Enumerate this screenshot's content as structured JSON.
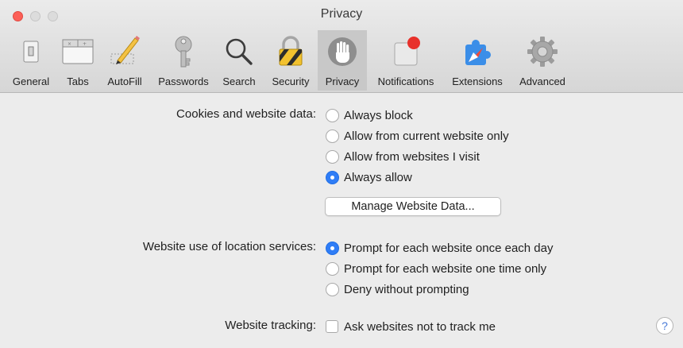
{
  "window": {
    "title": "Privacy"
  },
  "toolbar": {
    "tabs": [
      {
        "label": "General"
      },
      {
        "label": "Tabs"
      },
      {
        "label": "AutoFill"
      },
      {
        "label": "Passwords"
      },
      {
        "label": "Search"
      },
      {
        "label": "Security"
      },
      {
        "label": "Privacy",
        "selected": true
      },
      {
        "label": "Notifications"
      },
      {
        "label": "Extensions"
      },
      {
        "label": "Advanced"
      }
    ]
  },
  "cookies": {
    "label": "Cookies and website data:",
    "options": [
      {
        "label": "Always block",
        "selected": false
      },
      {
        "label": "Allow from current website only",
        "selected": false
      },
      {
        "label": "Allow from websites I visit",
        "selected": false
      },
      {
        "label": "Always allow",
        "selected": true
      }
    ],
    "manage_button": "Manage Website Data..."
  },
  "location": {
    "label": "Website use of location services:",
    "options": [
      {
        "label": "Prompt for each website once each day",
        "selected": true
      },
      {
        "label": "Prompt for each website one time only",
        "selected": false
      },
      {
        "label": "Deny without prompting",
        "selected": false
      }
    ]
  },
  "tracking": {
    "label": "Website tracking:",
    "checkbox_label": "Ask websites not to track me",
    "checked": false
  },
  "help": {
    "symbol": "?"
  },
  "colors": {
    "accent": "#2f7df6",
    "close": "#fc5f57"
  }
}
